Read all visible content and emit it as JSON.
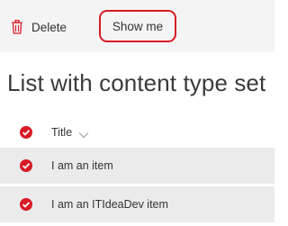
{
  "toolbar": {
    "delete_label": "Delete",
    "show_me_label": "Show me"
  },
  "list": {
    "title": "List with content type set",
    "column_header": "Title",
    "items": [
      {
        "title": "I am an item"
      },
      {
        "title": "I am an ITIdeaDev item"
      }
    ]
  },
  "colors": {
    "accent_red": "#d71a25",
    "toolbar_bg": "#f4f4f4",
    "row_selected_bg": "#ebebeb"
  },
  "icons": {
    "delete": "trash-icon",
    "select": "checkmark-circle-icon",
    "sort": "chevron-down-icon"
  }
}
